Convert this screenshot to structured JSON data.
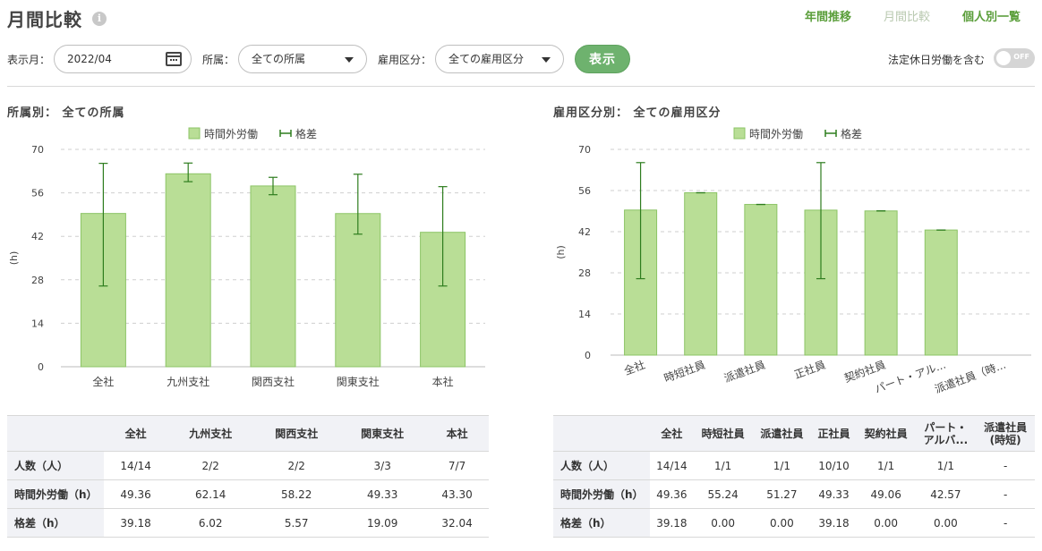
{
  "page": {
    "title": "月間比較",
    "info_icon": "info-icon"
  },
  "nav": {
    "yearly": "年間推移",
    "monthly": "月間比較",
    "individual": "個人別一覧"
  },
  "filters": {
    "month_label": "表示月：",
    "month_value": "2022/04",
    "dept_label": "所属：",
    "dept_value": "全ての所属",
    "emp_label": "雇用区分：",
    "emp_value": "全ての雇用区分",
    "show_button": "表示",
    "holiday_label": "法定休日労働を含む",
    "toggle_state": "OFF"
  },
  "legend": {
    "bar": "時間外労働",
    "error": "格差"
  },
  "colors": {
    "bar_fill": "#b9de96",
    "bar_stroke": "#8cc466",
    "error": "#2e7d1e",
    "accent": "#5a9e3a"
  },
  "chart_data": [
    {
      "type": "bar",
      "title": "所属別： 全ての所属",
      "ylabel": "(h)",
      "ylim": [
        0,
        70
      ],
      "yticks": [
        0,
        14,
        28,
        42,
        56,
        70
      ],
      "categories": [
        "全社",
        "九州支社",
        "関西支社",
        "関東支社",
        "本社"
      ],
      "values": [
        49.36,
        62.14,
        58.22,
        49.33,
        43.3
      ],
      "error_range": [
        [
          26,
          65.5
        ],
        [
          59.6,
          65.6
        ],
        [
          55.4,
          61
        ],
        [
          42.7,
          62
        ],
        [
          26,
          58
        ]
      ],
      "gridlines": true,
      "legend_position": "top"
    },
    {
      "type": "bar",
      "title": "雇用区分別： 全ての雇用区分",
      "ylabel": "(h)",
      "ylim": [
        0,
        70
      ],
      "yticks": [
        0,
        14,
        28,
        42,
        56,
        70
      ],
      "categories": [
        "全社",
        "時短社員",
        "派遣社員",
        "正社員",
        "契約社員",
        "パート・アル...",
        "派遣社員（時..."
      ],
      "values": [
        49.36,
        55.24,
        51.27,
        49.33,
        49.06,
        42.57,
        null
      ],
      "error_range": [
        [
          26,
          65.5
        ],
        [
          55.24,
          55.24
        ],
        [
          51.27,
          51.27
        ],
        [
          26,
          65.5
        ],
        [
          49.06,
          49.06
        ],
        [
          42.57,
          42.57
        ],
        null
      ],
      "gridlines": true,
      "legend_position": "top"
    }
  ],
  "table_left": {
    "headers": [
      "",
      "全社",
      "九州支社",
      "関西支社",
      "関東支社",
      "本社"
    ],
    "rows": [
      [
        "人数（人）",
        "14/14",
        "2/2",
        "2/2",
        "3/3",
        "7/7"
      ],
      [
        "時間外労働（h）",
        "49.36",
        "62.14",
        "58.22",
        "49.33",
        "43.30"
      ],
      [
        "格差（h）",
        "39.18",
        "6.02",
        "5.57",
        "19.09",
        "32.04"
      ]
    ]
  },
  "table_right": {
    "headers": [
      "",
      "全社",
      "時短社員",
      "派遣社員",
      "正社員",
      "契約社員",
      "パート・\nアルバ...",
      "派遣社員\n(時短)"
    ],
    "rows": [
      [
        "人数（人）",
        "14/14",
        "1/1",
        "1/1",
        "10/10",
        "1/1",
        "1/1",
        "-"
      ],
      [
        "時間外労働（h）",
        "49.36",
        "55.24",
        "51.27",
        "49.33",
        "49.06",
        "42.57",
        "-"
      ],
      [
        "格差（h）",
        "39.18",
        "0.00",
        "0.00",
        "39.18",
        "0.00",
        "0.00",
        "-"
      ]
    ]
  }
}
